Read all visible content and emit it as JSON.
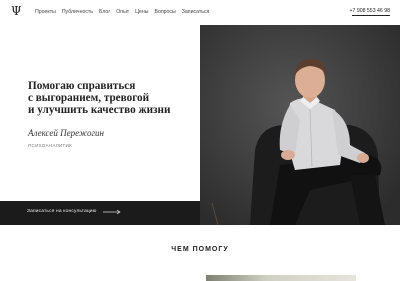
{
  "nav": {
    "logo": "Ψ",
    "items": [
      "Проекты",
      "Публичность",
      "Блог",
      "Опыт",
      "Цены",
      "Вопросы",
      "Записаться"
    ],
    "phone": "+7 908 553 46 98"
  },
  "hero": {
    "headline_lines": [
      "Помогаю справиться",
      "с выгоранием, тревогой",
      "и улучшить качество жизни"
    ],
    "author": "Алексей Пережогин",
    "role": "психоаналитик"
  },
  "cta": {
    "label": "Записаться на консультацию"
  },
  "section": {
    "title": "ЧЕМ ПОМОГУ"
  },
  "colors": {
    "dark": "#1b1b1b",
    "accent_text": "#222222",
    "background": "#ffffff"
  }
}
